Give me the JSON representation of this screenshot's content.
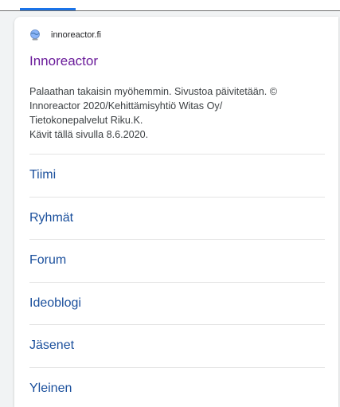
{
  "result": {
    "site_url": "innoreactor.fi",
    "favicon": "globe-favicon-icon",
    "title": "Innoreactor",
    "snippet_lines": [
      "Palaathan takaisin myöhemmin. Sivustoa päivitetään. ©",
      "Innoreactor 2020/Kehittämisyhtiö Witas Oy/",
      "Tietokonepalvelut Riku.K.",
      "Kävit tällä sivulla 8.6.2020."
    ],
    "sitelinks": [
      {
        "label": "Tiimi"
      },
      {
        "label": "Ryhmät"
      },
      {
        "label": "Forum"
      },
      {
        "label": "Ideoblogi"
      },
      {
        "label": "Jäsenet"
      },
      {
        "label": "Yleinen"
      }
    ]
  },
  "colors": {
    "title": "#6a1b9a",
    "sitelink": "#1a4f9c",
    "snippet": "#3c4043",
    "tab_indicator": "#1a73e8",
    "page_background": "#f1f3f4"
  }
}
